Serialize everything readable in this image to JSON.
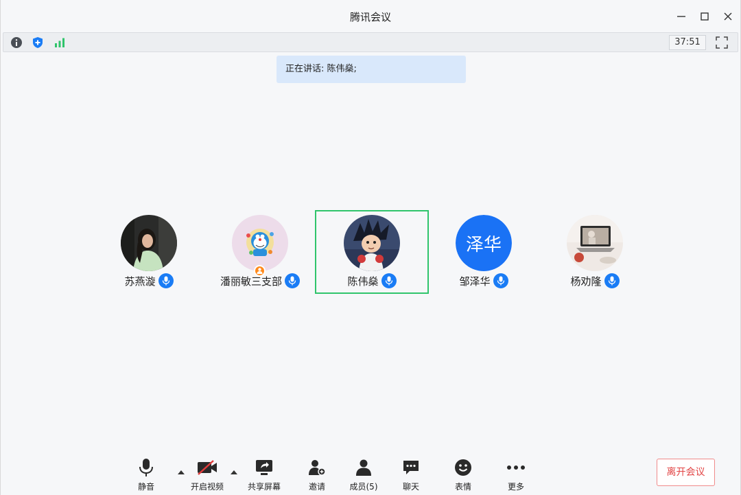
{
  "window": {
    "title": "腾讯会议"
  },
  "infobar": {
    "icons": [
      "info-icon",
      "shield-icon",
      "signal-icon"
    ],
    "timer": "37:51"
  },
  "speaking": {
    "text": "正在讲话: 陈伟燊;"
  },
  "participants": [
    {
      "name": "苏燕漩",
      "avatar": "photo-woman",
      "mic": "mic-on"
    },
    {
      "name": "潘丽敏三支部",
      "avatar": "doraemon",
      "mic": "mic-on",
      "host": true
    },
    {
      "name": "陈伟燊",
      "avatar": "goku",
      "mic": "mic-on",
      "active": true
    },
    {
      "name": "邹泽华",
      "avatar": "initials",
      "initials": "泽华",
      "mic": "mic-on",
      "color": "#1a72f5"
    },
    {
      "name": "杨劝隆",
      "avatar": "laptop-photo",
      "mic": "mic-on"
    }
  ],
  "controls": {
    "mute": "静音",
    "video": "开启视频",
    "share": "共享屏幕",
    "invite": "邀请",
    "members": "成员(5)",
    "chat": "聊天",
    "emoji": "表情",
    "more": "更多",
    "leave": "离开会议"
  },
  "colors": {
    "accent": "#1a7cf5",
    "active_border": "#2fc46b",
    "leave": "#e24545",
    "banner": "#d9e8fb"
  }
}
